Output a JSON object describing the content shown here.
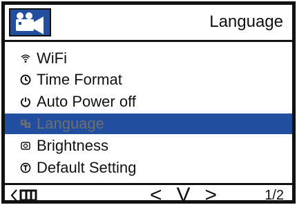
{
  "header": {
    "title": "Language",
    "icon": "video-camera-icon"
  },
  "menu": {
    "items": [
      {
        "label": "WiFi",
        "icon": "wifi-icon"
      },
      {
        "label": "Time Format",
        "icon": "clock-icon"
      },
      {
        "label": "Auto Power off",
        "icon": "power-icon"
      },
      {
        "label": "Language",
        "icon": "language-icon",
        "selected": true
      },
      {
        "label": "Brightness",
        "icon": "brightness-icon"
      },
      {
        "label": "Default Setting",
        "icon": "default-setting-icon"
      }
    ]
  },
  "footer": {
    "back_icon": "back-icon",
    "mode_icon": "menu-icon",
    "nav": {
      "left": "<",
      "down": "V",
      "right": ">"
    },
    "page": "1/2"
  },
  "colors": {
    "selection": "#214e9f",
    "selected_text": "#6f6f6f",
    "text": "#111111",
    "background": "#ffffff"
  }
}
